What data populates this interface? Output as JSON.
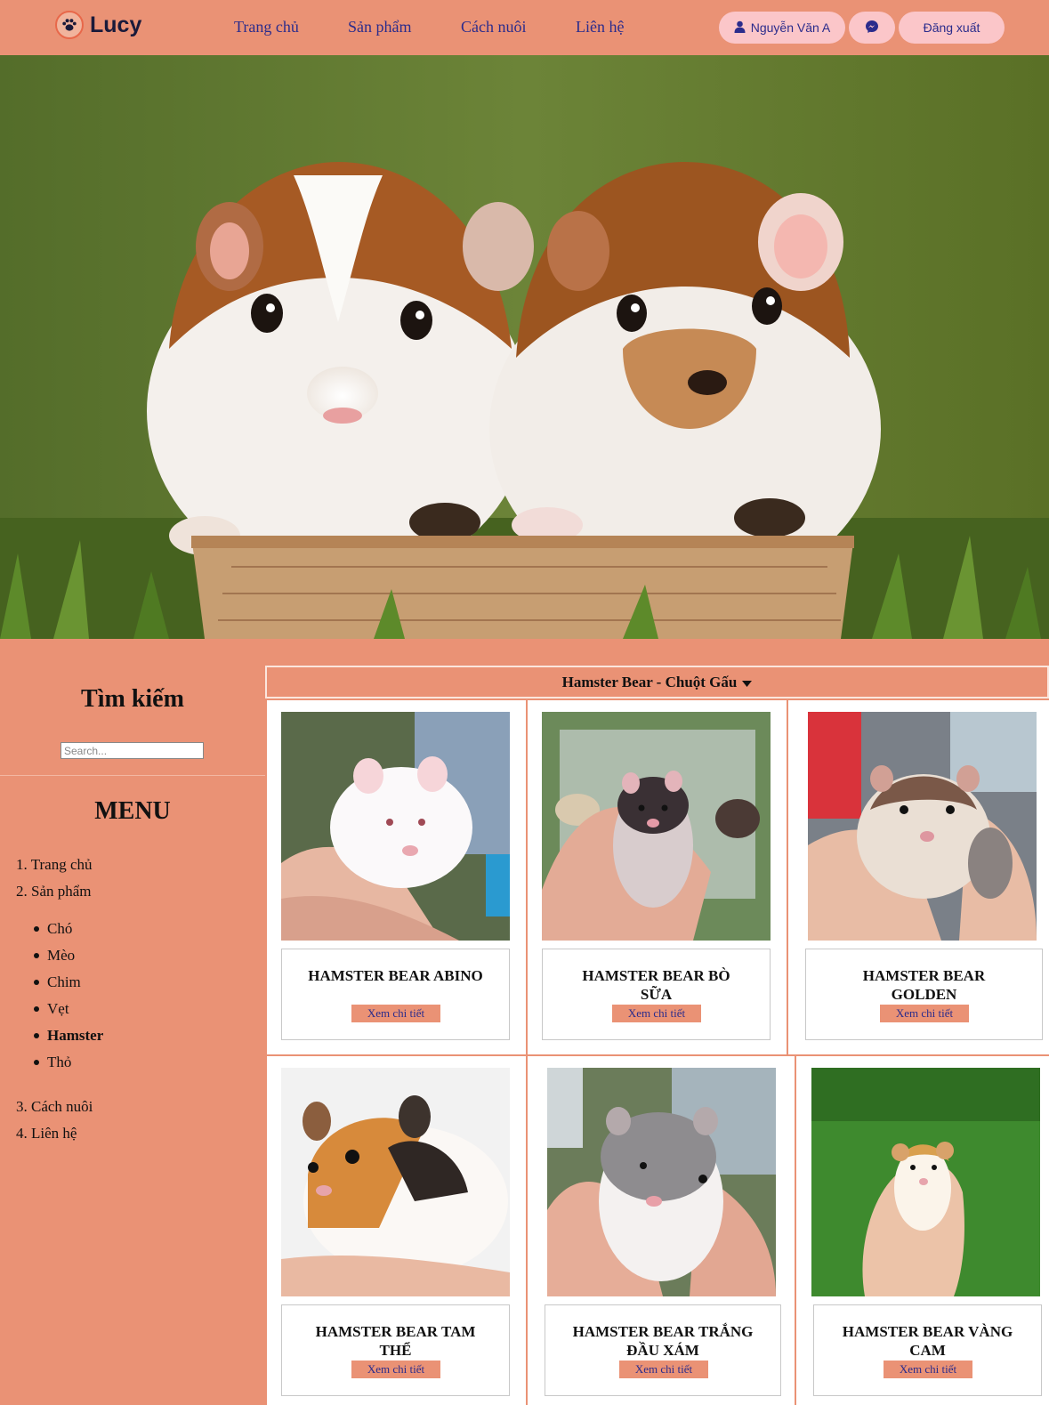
{
  "header": {
    "brand": "Lucy",
    "nav": [
      "Trang chủ",
      "Sản phẩm",
      "Cách nuôi",
      "Liên hệ"
    ],
    "user_label": "Nguyễn Văn A",
    "logout_label": "Đăng xuất"
  },
  "sidebar": {
    "search_title": "Tìm kiếm",
    "search_placeholder": "Search...",
    "menu_title": "MENU",
    "menu": [
      {
        "number": "1.",
        "label": "Trang chủ"
      },
      {
        "number": "2.",
        "label": "Sản phẩm"
      },
      {
        "number": "3.",
        "label": "Cách nuôi"
      },
      {
        "number": "4.",
        "label": "Liên hệ"
      }
    ],
    "sub_items": [
      "Chó",
      "Mèo",
      "Chim",
      "Vẹt",
      "Hamster",
      "Thỏ"
    ],
    "active_sub_item": "Hamster"
  },
  "category": {
    "label": "Hamster Bear - Chuột Gấu"
  },
  "products": [
    {
      "name": "HAMSTER BEAR ABINO",
      "button": "Xem chi tiết"
    },
    {
      "name": "HAMSTER BEAR BÒ SỮA",
      "button": "Xem chi tiết"
    },
    {
      "name": "HAMSTER BEAR GOLDEN",
      "button": "Xem chi tiết"
    },
    {
      "name": "HAMSTER BEAR TAM THỂ",
      "button": "Xem chi tiết"
    },
    {
      "name": "HAMSTER BEAR TRẮNG ĐẦU XÁM",
      "button": "Xem chi tiết"
    },
    {
      "name": "HAMSTER BEAR VÀNG CAM",
      "button": "Xem chi tiết"
    }
  ],
  "icons": {
    "logo": "paw-icon",
    "user": "user-icon",
    "messenger": "messenger-icon",
    "dropdown": "caret-down-icon"
  },
  "colors": {
    "primary": "#ea9275",
    "pill": "#fbc6c9",
    "link": "#2b2c8c"
  }
}
